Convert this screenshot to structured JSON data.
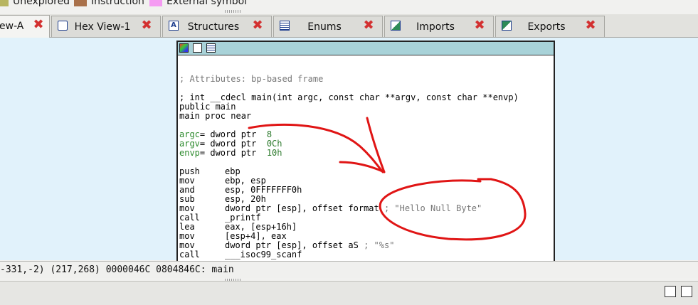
{
  "legend": [
    {
      "label": "Unexplored",
      "color": "#b8b560"
    },
    {
      "label": "Instruction",
      "color": "#a9714a"
    },
    {
      "label": "External symbol",
      "color": "#f59bf2"
    }
  ],
  "tabs": [
    {
      "label": "IDA View-A",
      "visible_label": "ew-A",
      "active": true
    },
    {
      "label": "Hex View-1"
    },
    {
      "label": "Structures"
    },
    {
      "label": "Enums"
    },
    {
      "label": "Imports"
    },
    {
      "label": "Exports"
    }
  ],
  "code": {
    "attributes": "; Attributes: bp-based frame",
    "prototype": "; int __cdecl main(int argc, const char **argv, const char **envp)",
    "public": "public main",
    "proc": "main proc near",
    "vars": [
      {
        "name": "argc",
        "rest": "= dword ptr  ",
        "val": "8"
      },
      {
        "name": "argv",
        "rest": "= dword ptr  ",
        "val": "0Ch"
      },
      {
        "name": "envp",
        "rest": "= dword ptr  ",
        "val": "10h"
      }
    ],
    "instructions": [
      {
        "mn": "push",
        "op": "ebp"
      },
      {
        "mn": "mov",
        "op": "ebp, esp"
      },
      {
        "mn": "and",
        "op": "esp, 0FFFFFFF0h"
      },
      {
        "mn": "sub",
        "op": "esp, 20h"
      },
      {
        "mn": "mov",
        "op": "dword ptr [esp], offset format",
        "comment": " ; \"Hello Null Byte\""
      },
      {
        "mn": "call",
        "op": "_printf"
      },
      {
        "mn": "lea",
        "op": "eax, [esp+16h]"
      },
      {
        "mn": "mov",
        "op": "[esp+4], eax"
      },
      {
        "mn": "mov",
        "op": "dword ptr [esp], offset aS",
        "comment": " ; \"%s\""
      },
      {
        "mn": "call",
        "op": "___isoc99_scanf"
      }
    ]
  },
  "status": "-331,-2) (217,268) 0000046C 0804846C: main"
}
